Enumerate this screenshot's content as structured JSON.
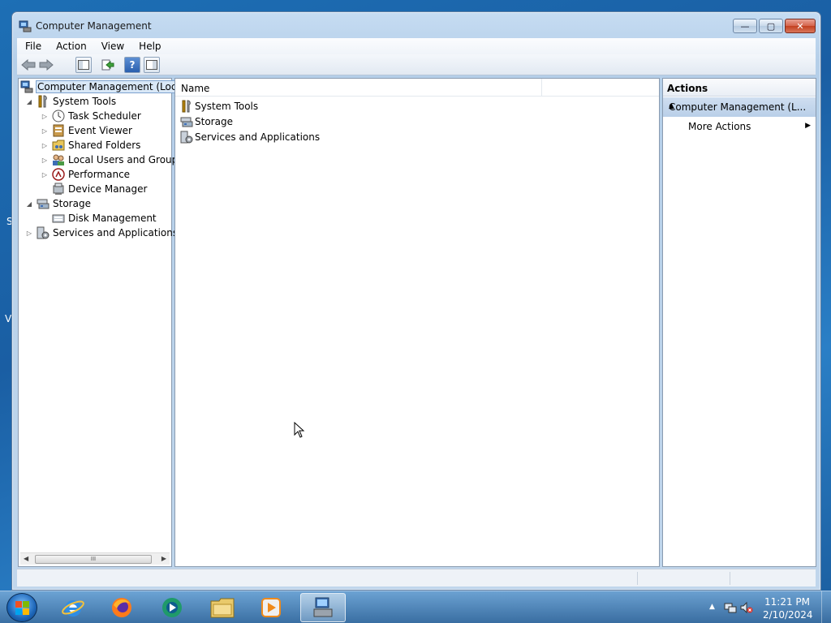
{
  "window": {
    "title": "Computer Management",
    "caption": {
      "minimize": "—",
      "maximize": "▢",
      "close": "✕"
    }
  },
  "desktop_edge": {
    "left_a": "S",
    "left_b": "V"
  },
  "menu": [
    "File",
    "Action",
    "View",
    "Help"
  ],
  "tree": {
    "items": [
      {
        "label": "Computer Management (Local",
        "icon": "computer-management-icon",
        "expander": ""
      },
      {
        "label": "System Tools",
        "icon": "system-tools-icon",
        "expander": "◢"
      },
      {
        "label": "Task Scheduler",
        "icon": "task-scheduler-icon",
        "expander": "▷"
      },
      {
        "label": "Event Viewer",
        "icon": "event-viewer-icon",
        "expander": "▷"
      },
      {
        "label": "Shared Folders",
        "icon": "shared-folders-icon",
        "expander": "▷"
      },
      {
        "label": "Local Users and Groups",
        "icon": "local-users-icon",
        "expander": "▷"
      },
      {
        "label": "Performance",
        "icon": "performance-icon",
        "expander": "▷"
      },
      {
        "label": "Device Manager",
        "icon": "device-manager-icon",
        "expander": ""
      },
      {
        "label": "Storage",
        "icon": "storage-icon",
        "expander": "◢"
      },
      {
        "label": "Disk Management",
        "icon": "disk-management-icon",
        "expander": ""
      },
      {
        "label": "Services and Applications",
        "icon": "services-icon",
        "expander": "▷"
      }
    ],
    "scroll_thumb": "III"
  },
  "content": {
    "column_header": "Name",
    "rows": [
      {
        "label": "System Tools",
        "icon": "system-tools-icon"
      },
      {
        "label": "Storage",
        "icon": "storage-icon"
      },
      {
        "label": "Services and Applications",
        "icon": "services-icon"
      }
    ]
  },
  "actions": {
    "header": "Actions",
    "section": "Computer Management (L...",
    "item": "More Actions"
  },
  "taskbar": {
    "apps": [
      "internet-explorer",
      "firefox",
      "media-center",
      "windows-explorer",
      "media-player",
      "computer-management"
    ],
    "time": "11:21 PM",
    "date": "2/10/2024"
  },
  "colors": {
    "selection": "#d9e8f7",
    "section_bg": "#c3d6ee",
    "desktop": "#1d6fb5"
  }
}
